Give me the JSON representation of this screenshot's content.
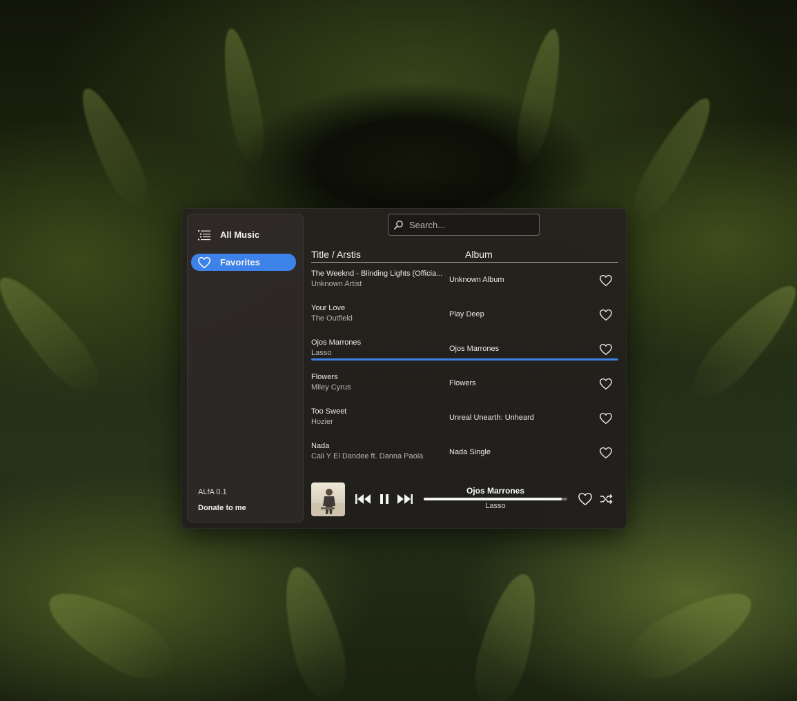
{
  "sidebar": {
    "items": [
      {
        "label": "All Music",
        "icon": "list-icon"
      },
      {
        "label": "Favorites",
        "icon": "heart-icon"
      }
    ],
    "version": "ALfA 0.1",
    "donate": "Donate to me"
  },
  "search": {
    "placeholder": "Search...",
    "value": ""
  },
  "list": {
    "header_title": "Title / Arstis",
    "header_album": "Album",
    "rows": [
      {
        "title": "The Weeknd - Blinding Lights (Officia...",
        "artist": "Unknown Artist",
        "album": "Unknown Album"
      },
      {
        "title": "Your Love",
        "artist": "The Outfield",
        "album": "Play Deep"
      },
      {
        "title": "Ojos Marrones",
        "artist": "Lasso",
        "album": "Ojos Marrones"
      },
      {
        "title": "Flowers",
        "artist": "Miley Cyrus",
        "album": "Flowers"
      },
      {
        "title": "Too Sweet",
        "artist": "Hozier",
        "album": "Unreal Unearth: Unheard"
      },
      {
        "title": "Nada",
        "artist": "Cali Y El Dandee ft. Danna Paola",
        "album": "Nada  Single"
      }
    ],
    "playing_index": 2
  },
  "player": {
    "title": "Ojos Marrones",
    "artist": "Lasso",
    "progress": 0.96,
    "icons": [
      "previous-icon",
      "pause-icon",
      "next-icon",
      "heart-icon",
      "shuffle-icon"
    ]
  },
  "colors": {
    "accent": "#3d82e8"
  }
}
